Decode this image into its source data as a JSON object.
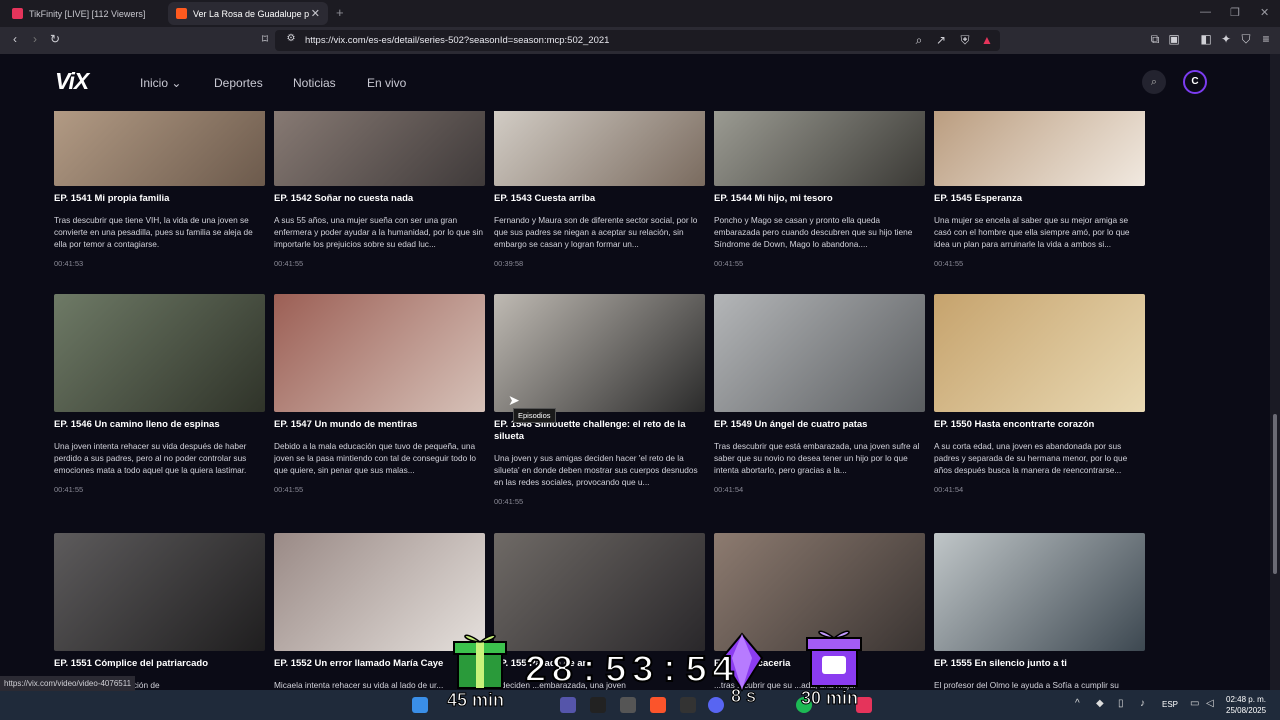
{
  "browser": {
    "tabs": [
      {
        "label": "TikFinity [LIVE] [112 Viewers]",
        "favicon_color": "#e5345b"
      },
      {
        "label": "Ver La Rosa de Guadalupe por V",
        "favicon_color": "#ff5a1f"
      }
    ],
    "url": "https://vix.com/es-es/detail/series-502?seasonId=season:mcp:502_2021",
    "status_url": "https://vix.com/video/video-4076511"
  },
  "site": {
    "logo": "ViX",
    "nav": [
      "Inicio",
      "Deportes",
      "Noticias",
      "En vivo"
    ],
    "avatar_initial": "C"
  },
  "tooltip": "Episodios",
  "episodes": [
    {
      "title": "EP. 1541  Mi propia familia",
      "desc": "Tras descubrir que tiene VIH, la vida de una joven se convierte en una pesadilla, pues su familia se aleja de ella por temor a contagiarse.",
      "dur": "00:41:53"
    },
    {
      "title": "EP. 1542  Soñar no cuesta nada",
      "desc": "A sus 55 años, una mujer sueña con ser una gran enfermera y poder ayudar a la humanidad, por lo que sin importarle los prejuicios sobre su edad luc...",
      "dur": "00:41:55"
    },
    {
      "title": "EP. 1543  Cuesta arriba",
      "desc": "Fernando y Maura son de diferente sector social, por lo que sus padres se niegan a aceptar su relación, sin embargo se casan y logran formar un...",
      "dur": "00:39:58"
    },
    {
      "title": "EP. 1544  Mi hijo, mi tesoro",
      "desc": "Poncho y Mago se casan y pronto ella queda embarazada pero cuando descubren que su hijo tiene Síndrome de Down, Mago lo abandona....",
      "dur": "00:41:55"
    },
    {
      "title": "EP. 1545  Esperanza",
      "desc": "Una mujer se encela al saber que su mejor amiga se casó con el hombre que ella siempre amó, por lo que idea un plan para arruinarle la vida a ambos si...",
      "dur": "00:41:55"
    },
    {
      "title": "EP. 1546  Un camino lleno de espinas",
      "desc": "Una joven intenta rehacer su vida después de haber perdido a sus padres, pero al no poder controlar sus emociones mata a todo aquel que la quiera lastimar.",
      "dur": "00:41:55"
    },
    {
      "title": "EP. 1547  Un mundo de mentiras",
      "desc": "Debido a la mala educación que tuvo de pequeña, una joven se la pasa mintiendo con tal de conseguir todo lo que quiere, sin penar que sus malas...",
      "dur": "00:41:55"
    },
    {
      "title": "EP. 1548  Silhouette challenge: el reto de la silueta",
      "desc": "Una joven y sus amigas deciden hacer 'el reto de la silueta' en donde deben mostrar sus cuerpos desnudos en las redes sociales, provocando que u...",
      "dur": "00:41:55"
    },
    {
      "title": "EP. 1549  Un ángel de cuatro patas",
      "desc": "Tras descubrir que está embarazada, una joven sufre al saber que su novio no desea tener un hijo por lo que intenta abortarlo, pero gracias a la...",
      "dur": "00:41:54"
    },
    {
      "title": "EP. 1550  Hasta encontrarte corazón",
      "desc": "A su corta edad, una joven es abandonada por sus padres y separada de su hermana menor, por lo que años después busca la manera de reencontrarse...",
      "dur": "00:41:54"
    },
    {
      "title": "EP. 1551  Cómplice del patriarcado",
      "desc": "...udios de administración de",
      "dur": ""
    },
    {
      "title": "EP. 1552  Un error llamado María Caye",
      "desc": "Micaela intenta rehacer su vida al lado de ur...",
      "dur": ""
    },
    {
      "title": "EP. 155  Parada de am",
      "desc": "...deciden ...embarazada, una joven",
      "dur": ""
    },
    {
      "title": "EP. 15  La caceria",
      "desc": "...tras ...cubrir que su ...ada, una mujer",
      "dur": ""
    },
    {
      "title": "EP. 1555  En silencio junto a ti",
      "desc": "El profesor del Olmo le ayuda a Sofía a cumplir su",
      "dur": ""
    }
  ],
  "overlay": {
    "timer": "28:53:54",
    "left_label": "45 min",
    "mid_label": "8 s",
    "right_label": "30 min"
  },
  "taskbar": {
    "lang": "ESP",
    "time": "02:48 p. m.",
    "date": "25/08/2025"
  }
}
